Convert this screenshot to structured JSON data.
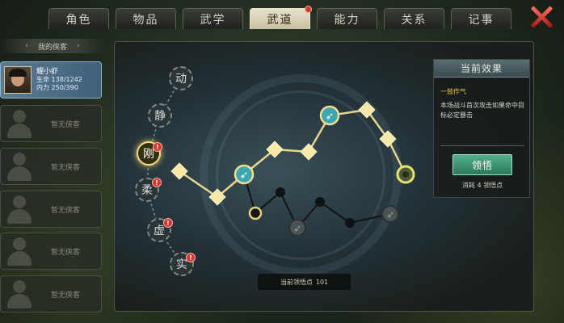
{
  "tabs": [
    {
      "label": "角色",
      "active": false,
      "dot": false
    },
    {
      "label": "物品",
      "active": false,
      "dot": false
    },
    {
      "label": "武学",
      "active": false,
      "dot": false
    },
    {
      "label": "武道",
      "active": true,
      "dot": true
    },
    {
      "label": "能力",
      "active": false,
      "dot": false
    },
    {
      "label": "关系",
      "active": false,
      "dot": false
    },
    {
      "label": "记事",
      "active": false,
      "dot": false
    }
  ],
  "sidebar": {
    "header": "我的侠客",
    "arrow_left": "‹",
    "arrow_right": "›",
    "selected": {
      "name": "耀小虾",
      "hp_label": "生命",
      "hp": "138/1242",
      "mp_label": "内力",
      "mp": "250/390"
    },
    "empty_label": "暂无侠客",
    "empty_count": 5
  },
  "tree": {
    "nodes": [
      {
        "char": "动",
        "lit": false,
        "badge": false
      },
      {
        "char": "静",
        "lit": false,
        "badge": false
      },
      {
        "char": "刚",
        "lit": true,
        "badge": true
      },
      {
        "char": "柔",
        "lit": false,
        "badge": true
      },
      {
        "char": "虚",
        "lit": false,
        "badge": true
      },
      {
        "char": "实",
        "lit": false,
        "badge": true
      }
    ],
    "badge_glyph": "!"
  },
  "points": {
    "label": "当前领悟点",
    "value": "101"
  },
  "effect": {
    "title": "当前效果",
    "name": "一鼓作气",
    "description": "本场战斗首次攻击如果命中目标必定暴击",
    "learn_button": "领悟",
    "cost": "消耗 4 领悟点"
  },
  "colors": {
    "gold": "#f2d88a",
    "active_tab": "#e0d8b8",
    "learn_green": "#3e9a72",
    "badge_red": "#d2362e"
  }
}
